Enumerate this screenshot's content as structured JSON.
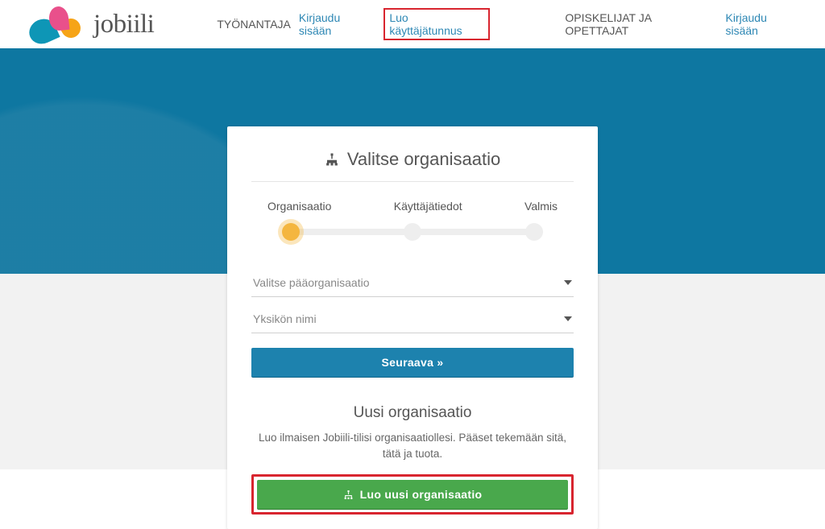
{
  "brand": {
    "name": "jobiili"
  },
  "nav": {
    "employer_label": "TYÖNANTAJA",
    "employer_login": "Kirjaudu sisään",
    "employer_create": "Luo käyttäjätunnus",
    "student_label": "OPISKELIJAT JA OPETTAJAT",
    "student_login": "Kirjaudu sisään"
  },
  "card": {
    "title": "Valitse organisaatio",
    "steps": {
      "s1": "Organisaatio",
      "s2": "Käyttäjätiedot",
      "s3": "Valmis",
      "active_index": 0
    },
    "select_org_placeholder": "Valitse pääorganisaatio",
    "select_unit_placeholder": "Yksikön nimi",
    "next_button": "Seuraava »",
    "new_org_title": "Uusi organisaatio",
    "new_org_desc": "Luo ilmaisen Jobiili-tilisi organisaatiollesi. Pääset tekemään sitä, tätä ja tuota.",
    "new_org_button": "Luo uusi organisaatio"
  }
}
